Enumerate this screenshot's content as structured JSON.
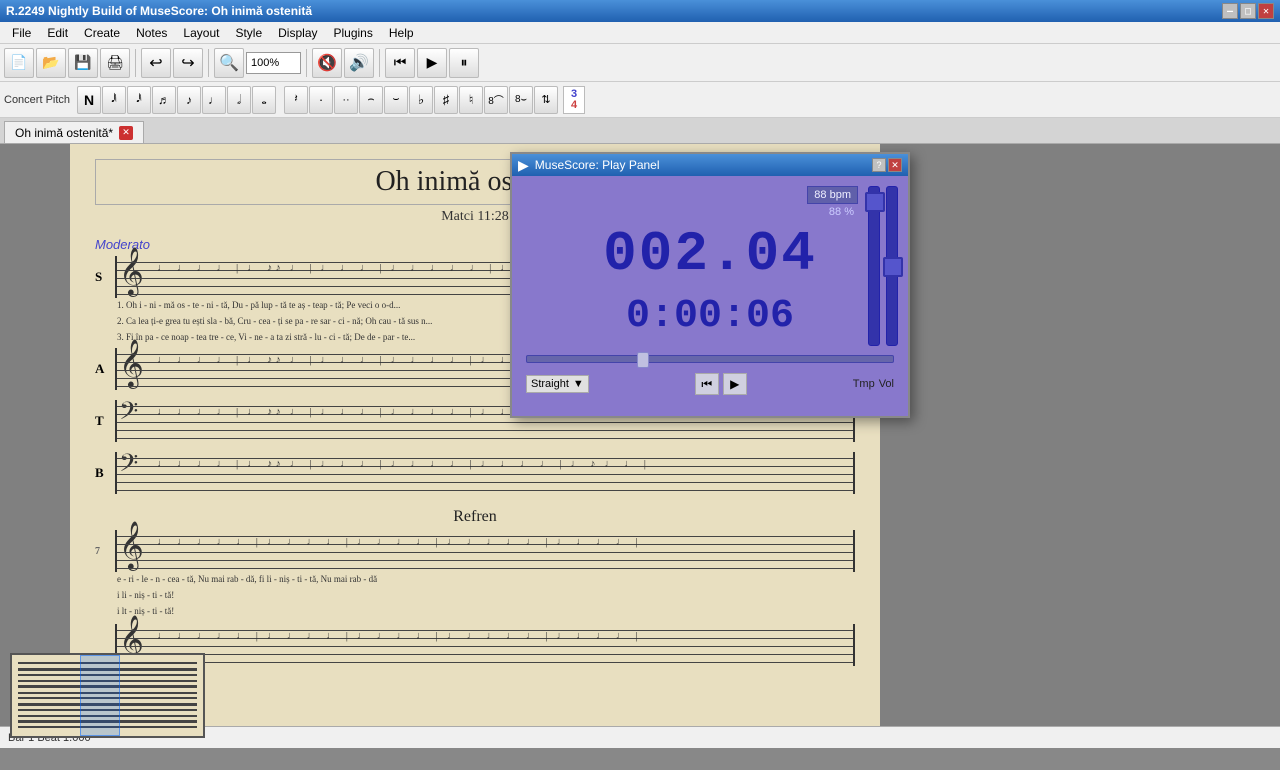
{
  "titlebar": {
    "title": "R.2249  Nightly Build of MuseScore: Oh inimă ostenită",
    "min_btn": "—",
    "max_btn": "□",
    "close_btn": "✕"
  },
  "menu": {
    "items": [
      "File",
      "Edit",
      "Create",
      "Notes",
      "Layout",
      "Style",
      "Display",
      "Plugins",
      "Help"
    ]
  },
  "toolbar": {
    "zoom_value": "100%",
    "buttons": [
      "📄",
      "📂",
      "💾",
      "🖨",
      "↩",
      "↺",
      "↻",
      "🔍",
      "◀",
      "▶",
      "⏸"
    ]
  },
  "note_toolbar": {
    "concert_pitch": "Concert Pitch",
    "time_sig_top": "3",
    "time_sig_bot": "4",
    "time_sig_top_color": "#4040cc",
    "time_sig_bot_color": "#cc4040"
  },
  "tab": {
    "label": "Oh inimă ostenită*",
    "close": "✕"
  },
  "score": {
    "title": "Oh inimă ostenită",
    "subtitle": "Matci 11:28",
    "tempo": "Moderato",
    "refren": "Refren",
    "voices": {
      "S": "S",
      "A": "A",
      "T": "T",
      "B": "B"
    },
    "lyrics": [
      "1. Oh  i - ni - mă os - te - ni - tă,  Du - pă  lup - tă  te  aș - teap - tă;  Pe  veci  o  o-d...",
      "2. Ca  lea  ți-e grea tu  ești sla - bă,  Cru - cea-ți  se  pa - re  sar - ci - nă;  Oh  cau - tă sus n...",
      "3. Fi  în  pa - ce  noap - tea  tre - ce,  Vi - ne - a   ta  zi  stră - lu - ci - tă;  De  de - par - te..."
    ],
    "refren_lyrics": "e - ri - le - n - cea - tă,     Nu  mai     rab - dă,  fi  li - niș - ti - tă,     Nu  mai     rab - dă"
  },
  "play_panel": {
    "title": "MuseScore: Play Panel",
    "icon": "▶",
    "help_btn": "?",
    "close_btn": "✕",
    "beat_display": "002.04",
    "time_display": "0:00:06",
    "bpm_value": "88 bpm",
    "bpm_percent": "88 %",
    "straight_label": "Straight",
    "rewind_btn": "⏮",
    "play_btn": "▶",
    "tmp_label": "Tmp",
    "vol_label": "Vol"
  },
  "status_bar": {
    "text": "Bar   1 Beat  1.000"
  }
}
